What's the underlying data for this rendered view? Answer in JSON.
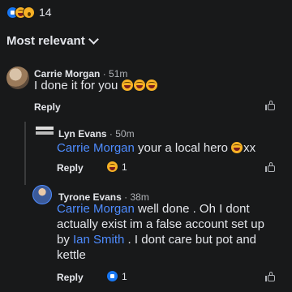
{
  "reactions": {
    "count": "14",
    "types": [
      "like-icon",
      "laugh-icon",
      "wow-icon"
    ]
  },
  "sort": {
    "label": "Most relevant"
  },
  "comments": [
    {
      "author": "Carrie Morgan",
      "time": "51m",
      "text": "I done it for you",
      "emoji_count": 3,
      "reply_label": "Reply"
    },
    {
      "author": "Lyn Evans",
      "time": "50m",
      "mention": "Carrie Morgan",
      "text": " your a local hero ",
      "text_tail": "xx",
      "reply_label": "Reply",
      "reaction_count": "1"
    },
    {
      "author": "Tyrone Evans",
      "time": "38m",
      "mention": "Carrie Morgan",
      "text_a": " well done . Oh I dont actually exist im a false account set up by ",
      "mention2": "Ian Smith",
      "text_b": " . I dont care but pot and kettle",
      "reply_label": "Reply",
      "reaction_count": "1"
    }
  ],
  "colors": {
    "background": "#18191a",
    "mention": "#4e8cff",
    "text": "#e4e6eb",
    "muted": "#b0b3b8"
  }
}
